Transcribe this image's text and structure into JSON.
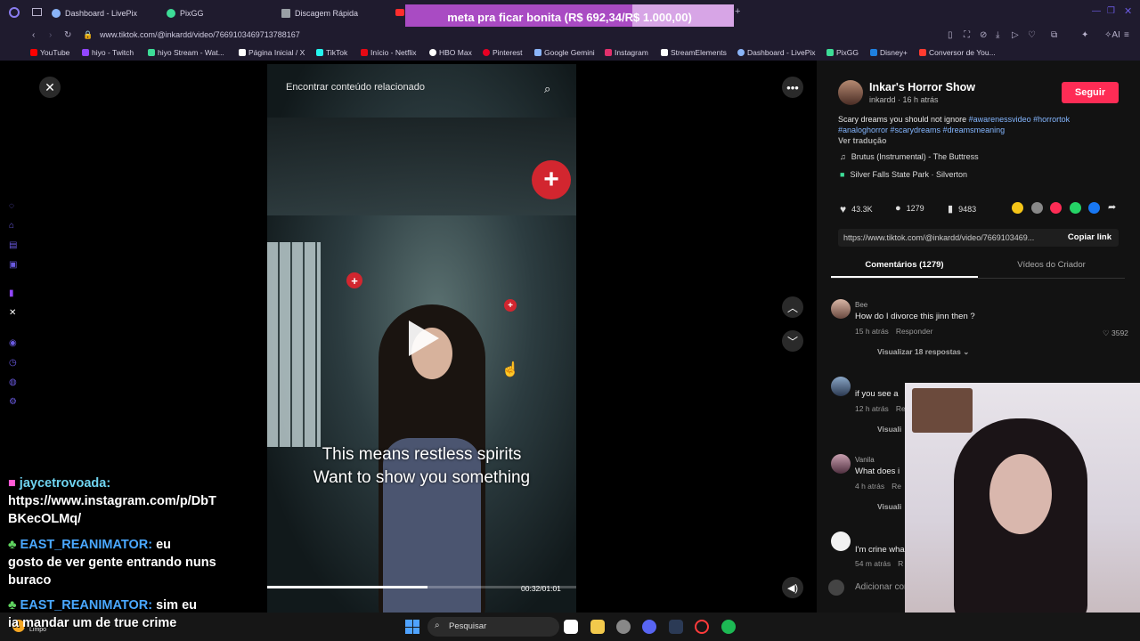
{
  "browser": {
    "tabs": [
      {
        "label": "Dashboard - LivePix",
        "color": "#8ab4f8"
      },
      {
        "label": "PixGG",
        "color": "#3ddc97"
      },
      {
        "label": "Discagem Rápida",
        "color": "#9aa0a6"
      }
    ],
    "donation_bar": {
      "text": "meta pra ficar bonita (R$ 692,34/R$ 1.000,00)",
      "progress": 0.69
    },
    "url": "www.tiktok.com/@inkardd/video/7669103469713788167",
    "bookmarks": [
      {
        "label": "YouTube",
        "color": "#ff0000"
      },
      {
        "label": "hiyo - Twitch",
        "color": "#9146ff"
      },
      {
        "label": "hiyo Stream - Wat...",
        "color": "#3ddc97"
      },
      {
        "label": "Página Inicial / X",
        "color": "#ffffff"
      },
      {
        "label": "TikTok",
        "color": "#25f4ee"
      },
      {
        "label": "Início - Netflix",
        "color": "#e50914"
      },
      {
        "label": "HBO Max",
        "color": "#ffffff"
      },
      {
        "label": "Pinterest",
        "color": "#e60023"
      },
      {
        "label": "Google Gemini",
        "color": "#8ab4f8"
      },
      {
        "label": "Instagram",
        "color": "#e1306c"
      },
      {
        "label": "StreamElements",
        "color": "#ffffff"
      },
      {
        "label": "Dashboard - LivePix",
        "color": "#8ab4f8"
      },
      {
        "label": "PixGG",
        "color": "#3ddc97"
      },
      {
        "label": "Disney+",
        "color": "#1f80e0"
      },
      {
        "label": "Conversor de You...",
        "color": "#ff3b30"
      }
    ]
  },
  "video": {
    "search_placeholder": "Encontrar conteúdo relacionado",
    "subtitle_line1": "This means restless spirits",
    "subtitle_line2": "Want to show you something",
    "timecode": "00:32/01:01",
    "progress": 0.52
  },
  "chat": {
    "messages": [
      {
        "user": "jaycetrovoada:",
        "lines": [
          "https://www.instagram.com/p/DbT",
          "BKecOLMq/"
        ]
      },
      {
        "user": "EAST_REANIMATOR:",
        "lines": [
          "eu",
          "gosto de ver gente entrando nuns",
          "buraco"
        ]
      },
      {
        "user": "EAST_REANIMATOR:",
        "lines": [
          "sim eu",
          "ia mandar um de true crime"
        ]
      }
    ]
  },
  "post": {
    "author_name": "Inkar's Horror Show",
    "author_meta": "inkardd · 16 h atrás",
    "follow_label": "Seguir",
    "description": "Scary dreams you should not ignore",
    "hashtags_line1": "#awarenessvideo #horrortok",
    "hashtags_line2": "#analoghorror #scarydreams #dreamsmeaning",
    "translate": "Ver tradução",
    "music": "Brutus (Instrumental) - The Buttress",
    "location": "Silver Falls State Park · Silverton",
    "likes": "43.3K",
    "comments_count": "1279",
    "saves": "9483",
    "link": "https://www.tiktok.com/@inkardd/video/7669103469...",
    "copy_label": "Copiar link",
    "tab_comments": "Comentários (1279)",
    "tab_videos": "Vídeos do Criador",
    "add_comment_placeholder": "Adicionar comentário..."
  },
  "comments": [
    {
      "user": "Bee",
      "text": "How do I divorce this jinn then ?",
      "time": "15 h atrás",
      "reply": "Responder",
      "likes": "3592",
      "view_replies": "Visualizar 18 respostas"
    },
    {
      "user": "",
      "text": "if you see a",
      "time": "12 h atrás",
      "reply": "Re",
      "view_replies": "Visuali"
    },
    {
      "user": "Vanila",
      "text": "What does i",
      "time": "4 h atrás",
      "reply": "Re",
      "view_replies": "Visuali"
    },
    {
      "user": "",
      "text": "I'm crine wha",
      "time": "54 m atrás",
      "reply": "R"
    }
  ],
  "taskbar": {
    "search_label": "Pesquisar",
    "weather": "Limpo"
  }
}
